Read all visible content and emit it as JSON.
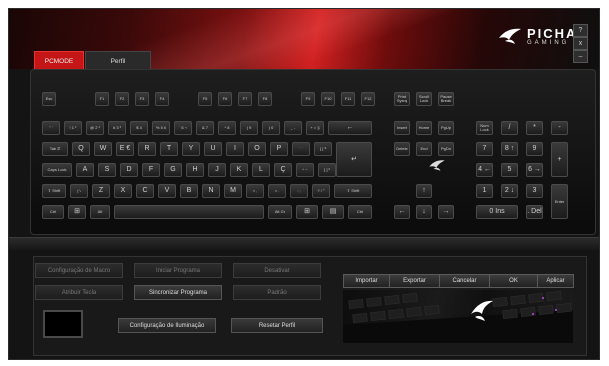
{
  "tabs": [
    {
      "label": "PCMODE",
      "active": true
    },
    {
      "label": "Perfil",
      "active": false
    }
  ],
  "logo": {
    "name": "PICHAU",
    "sub": "GAMING"
  },
  "window_buttons": {
    "help": "?",
    "close": "x",
    "minimize": "–"
  },
  "colors": {
    "accent": "#c41616",
    "panel": "#191919",
    "key": "#2c2c2c"
  },
  "keyboard": {
    "function_row": [
      "Esc",
      "F1",
      "F2",
      "F3",
      "F4",
      "F5",
      "F6",
      "F7",
      "F8",
      "F9",
      "F10",
      "F11",
      "F12"
    ],
    "system_keys": [
      "Print Sysrq",
      "Scroll Lock",
      "Pause Break"
    ],
    "number_row": [
      {
        "top": "\"",
        "bottom": "'"
      },
      {
        "top": "!",
        "bottom": "1 ¹"
      },
      {
        "top": "@",
        "bottom": "2 ²"
      },
      {
        "top": "#",
        "bottom": "3 ³"
      },
      {
        "top": "$",
        "bottom": "4"
      },
      {
        "top": "%",
        "bottom": "5 ¢"
      },
      {
        "top": "¨",
        "bottom": "6 ¬"
      },
      {
        "top": "&",
        "bottom": "7"
      },
      {
        "top": "*",
        "bottom": "8"
      },
      {
        "top": "(",
        "bottom": "9"
      },
      {
        "top": ")",
        "bottom": "0"
      },
      {
        "top": "_",
        "bottom": "-"
      },
      {
        "top": "+",
        "bottom": "= §"
      }
    ],
    "backspace": "←",
    "nav_top": [
      "Insert",
      "Home",
      "PgUp"
    ],
    "nav_mid": [
      "Delete",
      "End",
      "PgDn"
    ],
    "num_top": [
      "Num Lock",
      "/",
      "*",
      "-"
    ],
    "tab_label": "Tab ⭾",
    "qwerty": [
      "Q",
      "W",
      "E €",
      "R",
      "T",
      "Y",
      "U",
      "I",
      "O",
      "P",
      "` ´",
      "{ [ ª"
    ],
    "enter": "↵",
    "num_row2": [
      "7",
      "8 ↑",
      "9",
      "+"
    ],
    "capslock": "Caps Lock",
    "asdf": [
      "A",
      "S",
      "D",
      "F",
      "G",
      "H",
      "J",
      "K",
      "L",
      "Ç",
      "^ ~",
      "} ] º"
    ],
    "num_row3": [
      "4 ←",
      "5",
      "6 →"
    ],
    "lshift": "⇧ Shift",
    "zxcv": [
      "| \\",
      "Z",
      "X",
      "C",
      "V",
      "B",
      "N",
      "M",
      "< ,",
      "> .",
      ": ;",
      "? / °"
    ],
    "rshift": "⇧ Shift",
    "arrow_up": "↑",
    "num_row4": [
      "1",
      "2 ↓",
      "3"
    ],
    "num_enter": "Enter",
    "bottom_row": [
      "Ctrl",
      "⊞",
      "Alt",
      "Alt Gr",
      "⊞",
      "▤",
      "Ctrl"
    ],
    "arrows": [
      "←",
      "↓",
      "→"
    ],
    "num_zero": "0 Ins",
    "num_dot": ". Del"
  },
  "panel": {
    "buttons": [
      {
        "label": "Configuração de Macro",
        "disabled": true
      },
      {
        "label": "Iniciar Programa",
        "disabled": true
      },
      {
        "label": "Desativar",
        "disabled": true
      },
      {
        "label": "Atribuir Tecla",
        "disabled": true
      },
      {
        "label": "Sincronizar Programa",
        "disabled": false
      },
      {
        "label": "Padrão",
        "disabled": true
      }
    ],
    "lighting_button": "Configuração de Iluminação",
    "reset_button": "Resetar Perfil"
  },
  "actions": [
    "Importar",
    "Exportar",
    "Cancelar",
    "OK",
    "Aplicar"
  ]
}
